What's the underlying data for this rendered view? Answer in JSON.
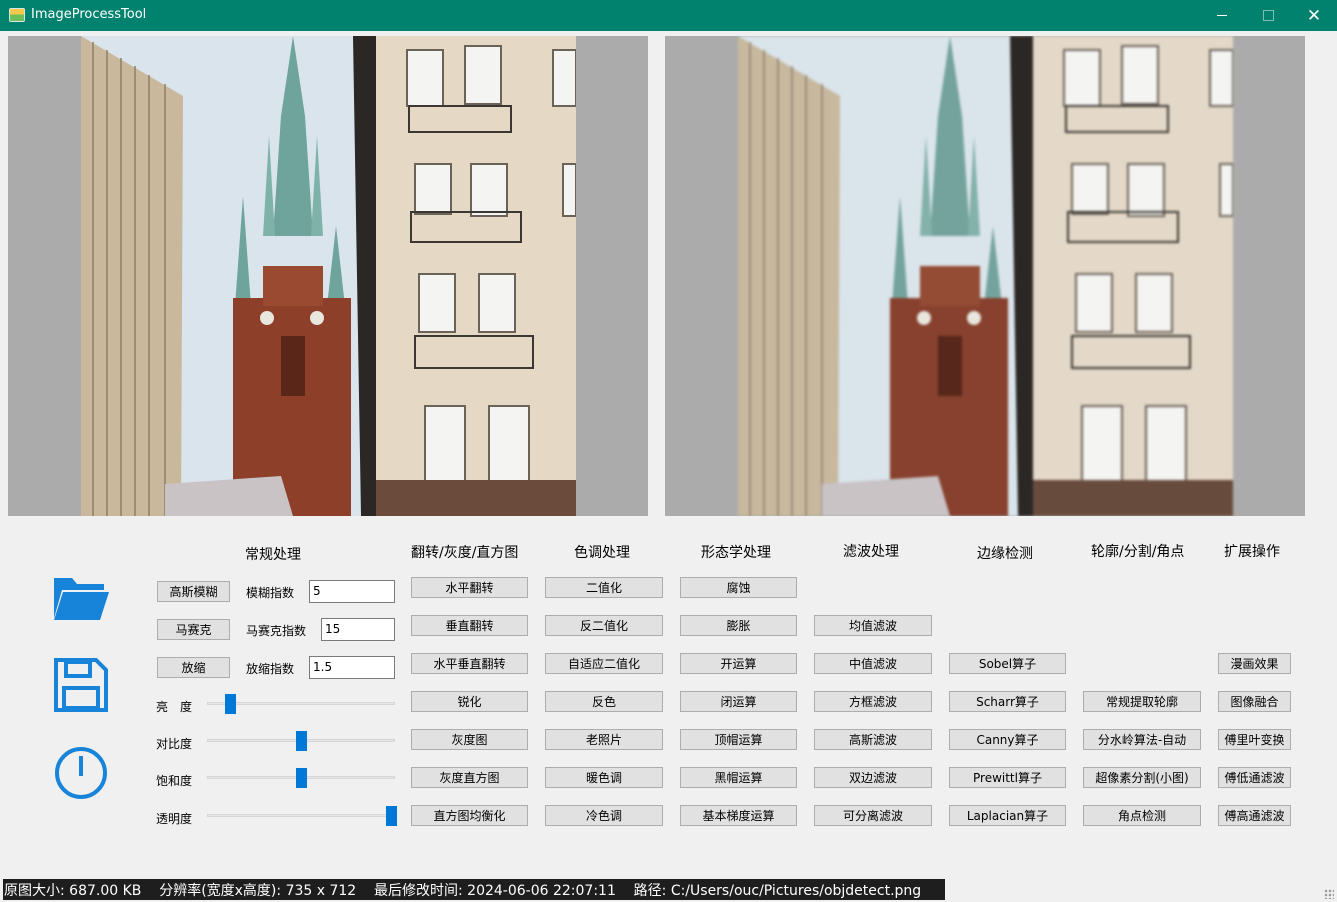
{
  "window": {
    "title": "ImageProcessTool",
    "close_glyph": "✕"
  },
  "icons": {
    "open": "folder-icon",
    "save": "save-icon",
    "exit": "power-icon",
    "accent": "#1784d9"
  },
  "headers": {
    "basic": "常规处理",
    "flip": "翻转/灰度/直方图",
    "color": "色调处理",
    "morph": "形态学处理",
    "filter": "滤波处理",
    "edge": "边缘检测",
    "contour": "轮廓/分割/角点",
    "ext": "扩展操作"
  },
  "basic": {
    "blur_button": "高斯模糊",
    "blur_label": "模糊指数",
    "blur_value": "5",
    "mosaic_button": "马赛克",
    "mosaic_label": "马赛克指数",
    "mosaic_value": "15",
    "scale_button": "放缩",
    "scale_label": "放缩指数",
    "scale_value": "1.5"
  },
  "sliders": [
    {
      "label": "亮　度",
      "value": 0.12
    },
    {
      "label": "对比度",
      "value": 0.5
    },
    {
      "label": "饱和度",
      "value": 0.5
    },
    {
      "label": "透明度",
      "value": 0.98
    }
  ],
  "flip_buttons": [
    "水平翻转",
    "垂直翻转",
    "水平垂直翻转",
    "锐化",
    "灰度图",
    "灰度直方图",
    "直方图均衡化"
  ],
  "color_buttons": [
    "二值化",
    "反二值化",
    "自适应二值化",
    "反色",
    "老照片",
    "暖色调",
    "冷色调"
  ],
  "morph_buttons": [
    "腐蚀",
    "膨胀",
    "开运算",
    "闭运算",
    "顶帽运算",
    "黑帽运算",
    "基本梯度运算"
  ],
  "filter_buttons": [
    "均值滤波",
    "中值滤波",
    "方框滤波",
    "高斯滤波",
    "双边滤波",
    "可分离滤波"
  ],
  "edge_buttons": [
    "Sobel算子",
    "Scharr算子",
    "Canny算子",
    "Prewittl算子",
    "Laplacian算子"
  ],
  "contour_buttons": [
    "常规提取轮廓",
    "分水岭算法-自动",
    "超像素分割(小图)",
    "角点检测"
  ],
  "ext_buttons": [
    "漫画效果",
    "图像融合",
    "傅里叶变换",
    "傅低通滤波",
    "傅高通滤波"
  ],
  "status": {
    "text": "原图大小: 687.00 KB    分辨率(宽度x高度): 735 x 712    最后修改时间: 2024-06-06 22:07:11    路径: C:/Users/ouc/Pictures/objdetect.png"
  }
}
